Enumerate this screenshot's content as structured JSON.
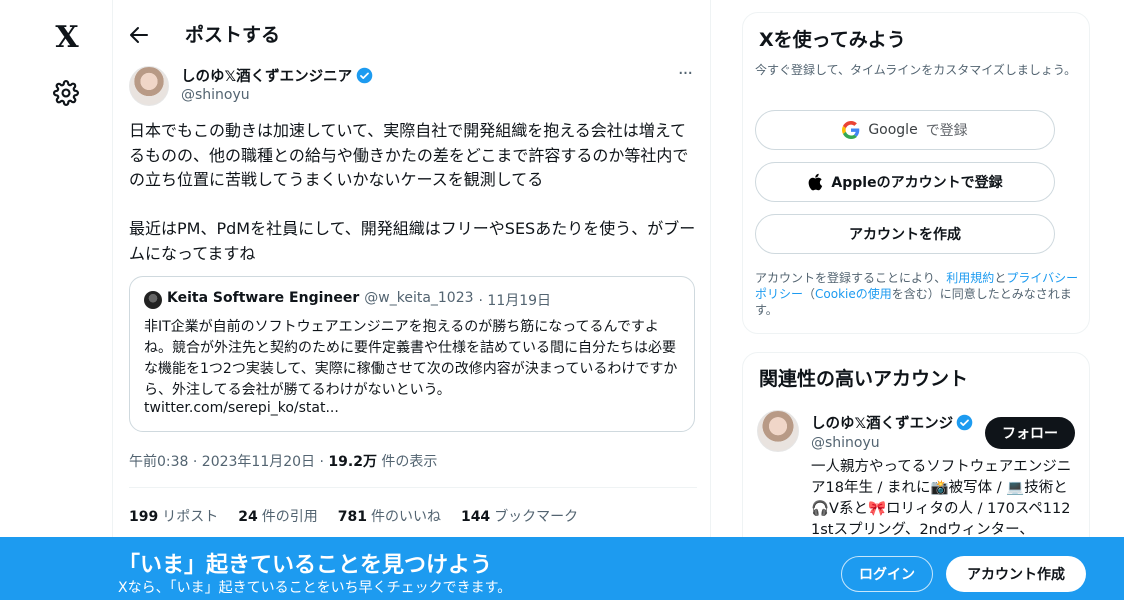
{
  "nav": {
    "logo_glyph": "X",
    "settings_icon": "gear-icon"
  },
  "header": {
    "title": "ポストする",
    "back_icon": "arrow-left-icon"
  },
  "post": {
    "author_name": "しのゆ𝕏酒くずエンジニア",
    "author_handle": "@shinoyu",
    "more_glyph": "···",
    "text": "日本でもこの動きは加速していて、実際自社で開発組織を抱える会社は増えてるものの、他の職種との給与や働きかたの差をどこまで許容するのか等社内での立ち位置に苦戦してうまくいかないケースを観測してる\n\n最近はPM、PdMを社員にして、開発組織はフリーやSESあたりを使う、がブームになってますね",
    "quote": {
      "name": "Keita Software Engineer",
      "handle": "@w_keita_1023",
      "date": "· 11月19日",
      "text": "非IT企業が自前のソフトウェアエンジニアを抱えるのが勝ち筋になってるんですよね。競合が外注先と契約のために要件定義書や仕様を詰めている間に自分たちは必要な機能を1つ2つ実装して、実際に稼働させて次の改修内容が決まっているわけですから、外注してる会社が勝てるわけがないという。",
      "link": "twitter.com/serepi_ko/stat..."
    },
    "time": "午前0:38 · 2023年11月20日 · ",
    "views_count": "19.2万",
    "views_label": " 件の表示",
    "stats": [
      {
        "count": "199",
        "label": "リポスト"
      },
      {
        "count": "24",
        "label": "件の引用"
      },
      {
        "count": "781",
        "label": "件のいいね"
      },
      {
        "count": "144",
        "label": "ブックマーク"
      }
    ]
  },
  "signup": {
    "title": "Xを使ってみよう",
    "subtitle": "今すぐ登録して、タイムラインをカスタマイズしましょう。",
    "google_label": "Google",
    "google_suffix": "で登録",
    "apple_label": "Appleのアカウントで登録",
    "create_label": "アカウントを作成",
    "terms_prefix": "アカウントを登録することにより、",
    "terms_link": "利用規約",
    "terms_and": "と",
    "privacy_link": "プライバシーポリシー",
    "terms_paren_open": "（",
    "cookie_link": "Cookieの使用",
    "terms_suffix": "を含む）に同意したとみなされます。"
  },
  "related": {
    "title": "関連性の高いアカウント",
    "name": "しのゆ𝕏酒くずエンジ",
    "handle": "@shinoyu",
    "follow_label": "フォロー",
    "bio": "一人親方やってるソフトウェアエンジニア18年生 / まれに📸被写体 / 💻技術と🎧V系と🎀ロリィタの人 / 170スペ112 1stスプリング、2ndウィンター、"
  },
  "bottom_bar": {
    "title": "「いま」起きていることを見つけよう",
    "subtitle": "Xなら、「いま」起きていることをいち早くチェックできます。",
    "login_label": "ログイン",
    "signup_label": "アカウント作成"
  },
  "colors": {
    "accent": "#1d9bf0",
    "text": "#0f1419",
    "muted": "#536471"
  }
}
